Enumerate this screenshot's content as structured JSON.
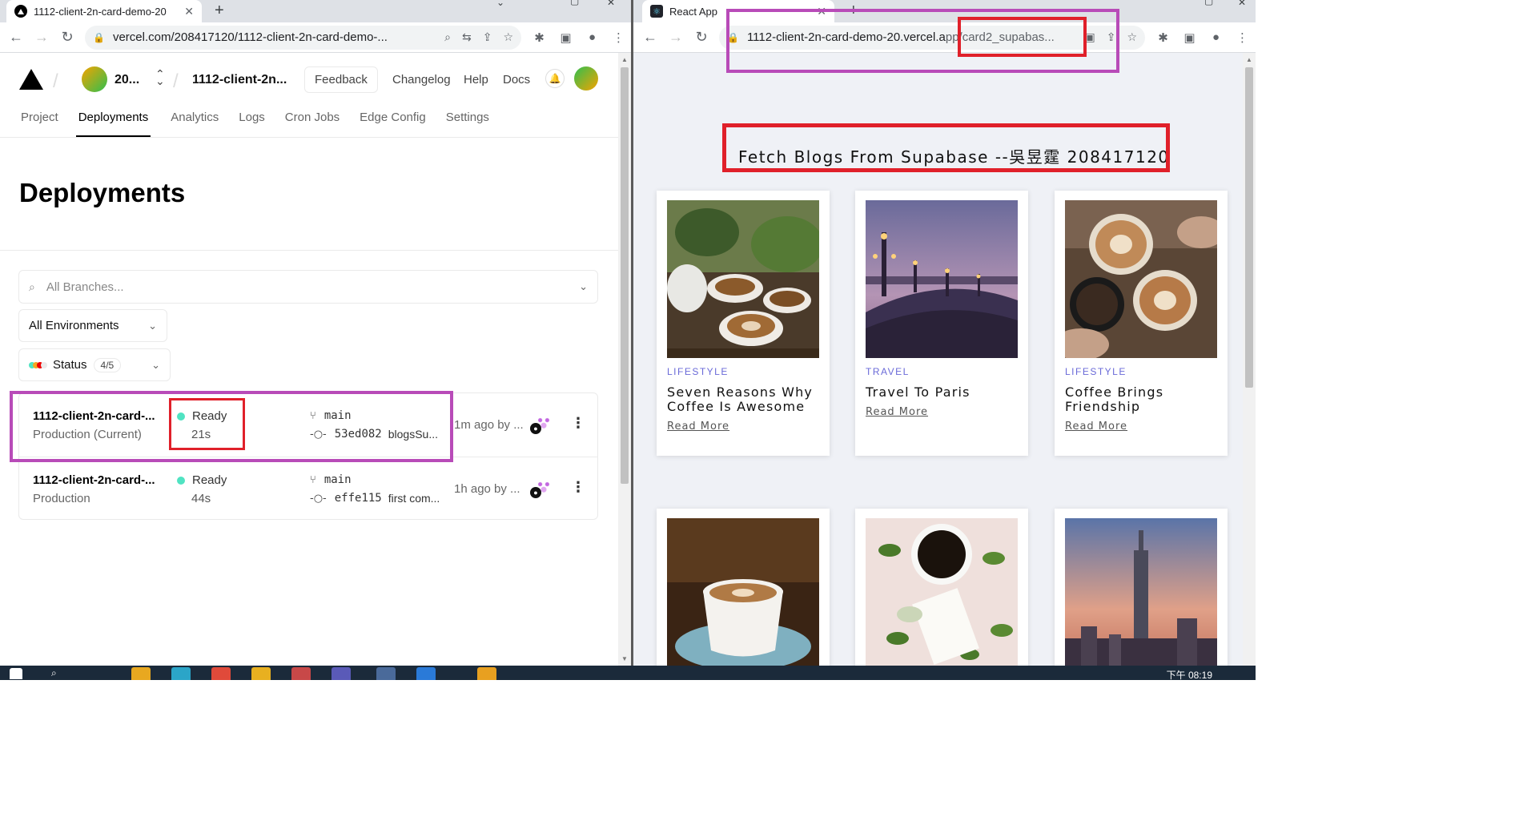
{
  "left_window": {
    "tab": {
      "title": "1112-client-2n-card-demo-20"
    },
    "address": "vercel.com/208417120/1112-client-2n-card-demo-...",
    "header": {
      "team_name": "20...",
      "project_name": "1112-client-2n...",
      "feedback_label": "Feedback",
      "links": [
        "Changelog",
        "Help",
        "Docs"
      ]
    },
    "nav": [
      "Project",
      "Deployments",
      "Analytics",
      "Logs",
      "Cron Jobs",
      "Edge Config",
      "Settings"
    ],
    "page_title": "Deployments",
    "filters": {
      "branch_placeholder": "All Branches...",
      "environment": "All Environments",
      "status_label": "Status",
      "status_count": "4/5"
    },
    "deployments": [
      {
        "name": "1112-client-2n-card-...",
        "environment": "Production (Current)",
        "status": "Ready",
        "duration": "21s",
        "branch": "main",
        "commit_hash": "53ed082",
        "commit_msg": "blogsSu...",
        "time": "1m ago by ..."
      },
      {
        "name": "1112-client-2n-card-...",
        "environment": "Production",
        "status": "Ready",
        "duration": "44s",
        "branch": "main",
        "commit_hash": "effe115",
        "commit_msg": "first com...",
        "time": "1h ago by ..."
      }
    ]
  },
  "right_window": {
    "tab": {
      "title": "React App"
    },
    "address_host": "1112-client-2n-card-demo-20.vercel.a",
    "address_path": "pp/card2_supabas...",
    "page_title": "Fetch Blogs From Supabase --吳昱霆 208417120",
    "cards": [
      {
        "category": "LIFESTYLE",
        "title": "Seven Reasons Why Coffee Is Awesome",
        "link": "Read More"
      },
      {
        "category": "TRAVEL",
        "title": "Travel To Paris",
        "link": "Read More"
      },
      {
        "category": "LIFESTYLE",
        "title": "Coffee Brings Friendship",
        "link": "Read More"
      }
    ]
  },
  "taskbar": {
    "clock": "下午 08:19"
  },
  "colors": {
    "ready_dot": "#50e3c2",
    "accent_purple": "#b84bb8",
    "accent_red": "#e0202a",
    "category": "#6a6ad8"
  }
}
